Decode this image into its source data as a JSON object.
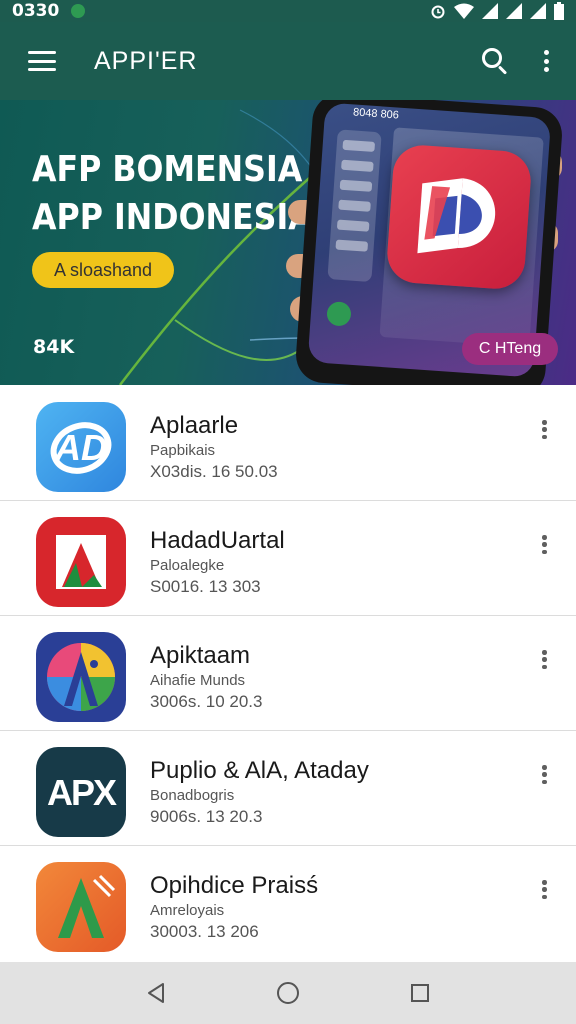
{
  "status_bar": {
    "time": "0330",
    "icons": [
      "notification-dot",
      "alarm-icon",
      "wifi-icon",
      "signal-icon",
      "signal-icon",
      "battery-icon"
    ]
  },
  "app_bar": {
    "title": "APPI'ER",
    "icons": [
      "menu-icon",
      "search-icon",
      "more-vert-icon"
    ]
  },
  "banner": {
    "headline_line1": "AFP BOMENSIA",
    "headline_line2": "APP INDONESIA",
    "cta_label": "A sloashand",
    "count": "84K",
    "badge_label": "C HTeng",
    "phone_topline": "8048 806",
    "colors": {
      "cta": "#f0c419",
      "badge": "#9b2e7f"
    }
  },
  "apps": [
    {
      "name": "Aplaarle",
      "publisher": "Papbikais",
      "meta": "X03dis. 16 50.03",
      "icon": "ad-logo-icon",
      "icon_color": "#3a9ae8"
    },
    {
      "name": "HadadUartal",
      "publisher": "Paloalegke",
      "meta": "S0016. 13 303",
      "icon": "a-logo-icon",
      "icon_color": "#d7262c"
    },
    {
      "name": "Apiktaam",
      "publisher": "Aihafie Munds",
      "meta": "3006s. 10 20.3",
      "icon": "a-palette-icon",
      "icon_color": "#2a3f96"
    },
    {
      "name": "Puplio & AlA, Ataday",
      "publisher": "Bonadbogris",
      "meta": "9006s. 13 20.3",
      "icon": "apx-logo-icon",
      "icon_color": "#173a48"
    },
    {
      "name": "Opihdice Praisś",
      "publisher": "Amreloyais",
      "meta": "30003. 13 206",
      "icon": "a-orange-logo-icon",
      "icon_color": "#f07a30"
    }
  ],
  "nav_bar": {
    "icons": [
      "back-icon",
      "home-icon",
      "recents-icon"
    ]
  }
}
